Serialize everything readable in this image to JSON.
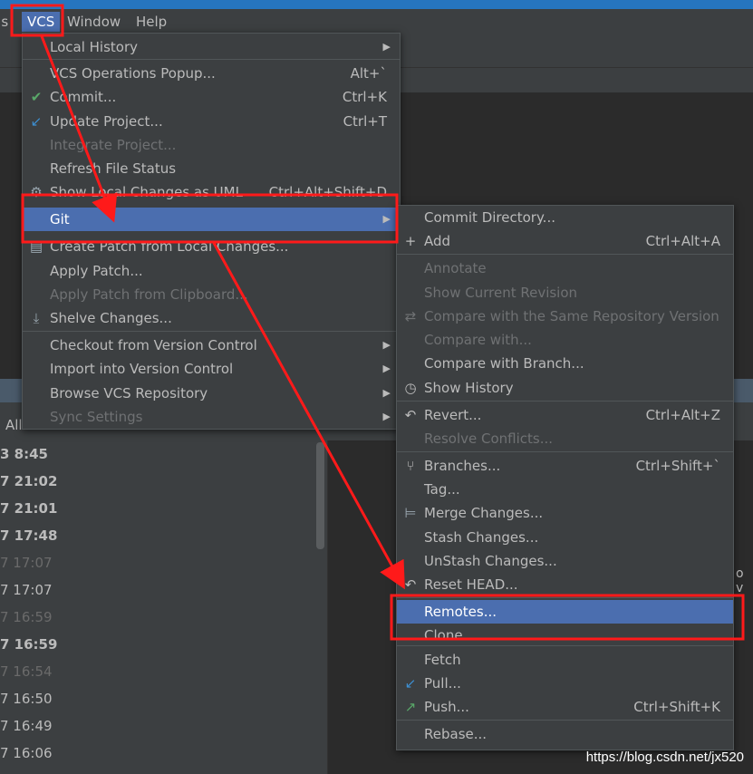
{
  "menubar": {
    "items": [
      {
        "label": "ols",
        "active": false
      },
      {
        "label": "VCS",
        "active": true
      },
      {
        "label": "Window",
        "active": false
      },
      {
        "label": "Help",
        "active": false
      }
    ]
  },
  "background": {
    "all_label": "All",
    "times": [
      {
        "text": "3 8:45",
        "style": "bold"
      },
      {
        "text": "7 21:02",
        "style": "bold"
      },
      {
        "text": "7 21:01",
        "style": "bold"
      },
      {
        "text": "7 17:48",
        "style": "bold"
      },
      {
        "text": "7 17:07",
        "style": "dim"
      },
      {
        "text": "7 17:07",
        "style": "norm"
      },
      {
        "text": "7 16:59",
        "style": "dim"
      },
      {
        "text": "7 16:59",
        "style": "bold"
      },
      {
        "text": "7 16:54",
        "style": "dim"
      },
      {
        "text": "7 16:50",
        "style": "norm"
      },
      {
        "text": "7 16:49",
        "style": "norm"
      },
      {
        "text": "7 16:06",
        "style": "norm"
      }
    ],
    "side_text": "o v"
  },
  "vcs_menu": {
    "items": [
      {
        "label": "Local History",
        "shortcut": "",
        "submenu": true,
        "disabled": false,
        "icon": ""
      },
      {
        "label": "VCS Operations Popup...",
        "shortcut": "Alt+`",
        "submenu": false,
        "disabled": false,
        "icon": ""
      },
      {
        "label": "Commit...",
        "shortcut": "Ctrl+K",
        "submenu": false,
        "disabled": false,
        "icon": "check-icon"
      },
      {
        "label": "Update Project...",
        "shortcut": "Ctrl+T",
        "submenu": false,
        "disabled": false,
        "icon": "update-arrow-icon"
      },
      {
        "label": "Integrate Project...",
        "shortcut": "",
        "submenu": false,
        "disabled": true,
        "icon": ""
      },
      {
        "label": "Refresh File Status",
        "shortcut": "",
        "submenu": false,
        "disabled": false,
        "icon": ""
      },
      {
        "label": "Show Local Changes as UML",
        "shortcut": "Ctrl+Alt+Shift+D",
        "submenu": false,
        "disabled": false,
        "icon": "uml-icon"
      },
      {
        "label": "Git",
        "shortcut": "",
        "submenu": true,
        "disabled": false,
        "icon": "",
        "selected": true
      },
      {
        "label": "Create Patch from Local Changes...",
        "shortcut": "",
        "submenu": false,
        "disabled": false,
        "icon": "patch-icon"
      },
      {
        "label": "Apply Patch...",
        "shortcut": "",
        "submenu": false,
        "disabled": false,
        "icon": ""
      },
      {
        "label": "Apply Patch from Clipboard...",
        "shortcut": "",
        "submenu": false,
        "disabled": true,
        "icon": ""
      },
      {
        "label": "Shelve Changes...",
        "shortcut": "",
        "submenu": false,
        "disabled": false,
        "icon": "shelve-icon"
      },
      {
        "label": "Checkout from Version Control",
        "shortcut": "",
        "submenu": true,
        "disabled": false,
        "icon": ""
      },
      {
        "label": "Import into Version Control",
        "shortcut": "",
        "submenu": true,
        "disabled": false,
        "icon": ""
      },
      {
        "label": "Browse VCS Repository",
        "shortcut": "",
        "submenu": true,
        "disabled": false,
        "icon": ""
      },
      {
        "label": "Sync Settings",
        "shortcut": "",
        "submenu": true,
        "disabled": true,
        "icon": ""
      }
    ]
  },
  "git_menu": {
    "items": [
      {
        "label": "Commit Directory...",
        "shortcut": "",
        "disabled": false,
        "icon": ""
      },
      {
        "label": "Add",
        "shortcut": "Ctrl+Alt+A",
        "disabled": false,
        "icon": "plus-icon"
      },
      {
        "label": "Annotate",
        "shortcut": "",
        "disabled": true,
        "icon": ""
      },
      {
        "label": "Show Current Revision",
        "shortcut": "",
        "disabled": true,
        "icon": ""
      },
      {
        "label": "Compare with the Same Repository Version",
        "shortcut": "",
        "disabled": true,
        "icon": "compare-icon"
      },
      {
        "label": "Compare with...",
        "shortcut": "",
        "disabled": true,
        "icon": ""
      },
      {
        "label": "Compare with Branch...",
        "shortcut": "",
        "disabled": false,
        "icon": ""
      },
      {
        "label": "Show History",
        "shortcut": "",
        "disabled": false,
        "icon": "clock-icon"
      },
      {
        "label": "Revert...",
        "shortcut": "Ctrl+Alt+Z",
        "disabled": false,
        "icon": "revert-icon"
      },
      {
        "label": "Resolve Conflicts...",
        "shortcut": "",
        "disabled": true,
        "icon": ""
      },
      {
        "label": "Branches...",
        "shortcut": "Ctrl+Shift+`",
        "disabled": false,
        "icon": "branch-icon"
      },
      {
        "label": "Tag...",
        "shortcut": "",
        "disabled": false,
        "icon": ""
      },
      {
        "label": "Merge Changes...",
        "shortcut": "",
        "disabled": false,
        "icon": "merge-icon"
      },
      {
        "label": "Stash Changes...",
        "shortcut": "",
        "disabled": false,
        "icon": ""
      },
      {
        "label": "UnStash Changes...",
        "shortcut": "",
        "disabled": false,
        "icon": ""
      },
      {
        "label": "Reset HEAD...",
        "shortcut": "",
        "disabled": false,
        "icon": "reset-icon"
      },
      {
        "label": "Remotes...",
        "shortcut": "",
        "disabled": false,
        "icon": "",
        "selected": true
      },
      {
        "label": "Clone...",
        "shortcut": "",
        "disabled": false,
        "icon": ""
      },
      {
        "label": "Fetch",
        "shortcut": "",
        "disabled": false,
        "icon": ""
      },
      {
        "label": "Pull...",
        "shortcut": "",
        "disabled": false,
        "icon": "pull-icon"
      },
      {
        "label": "Push...",
        "shortcut": "Ctrl+Shift+K",
        "disabled": false,
        "icon": "push-icon"
      },
      {
        "label": "Rebase...",
        "shortcut": "",
        "disabled": false,
        "icon": ""
      }
    ]
  },
  "watermark": "https://blog.csdn.net/jx520",
  "colors": {
    "accent": "#4b6eaf",
    "annotation": "#ff1a1a",
    "menu_bg": "#3c3f41",
    "title_bar": "#2675bf"
  }
}
